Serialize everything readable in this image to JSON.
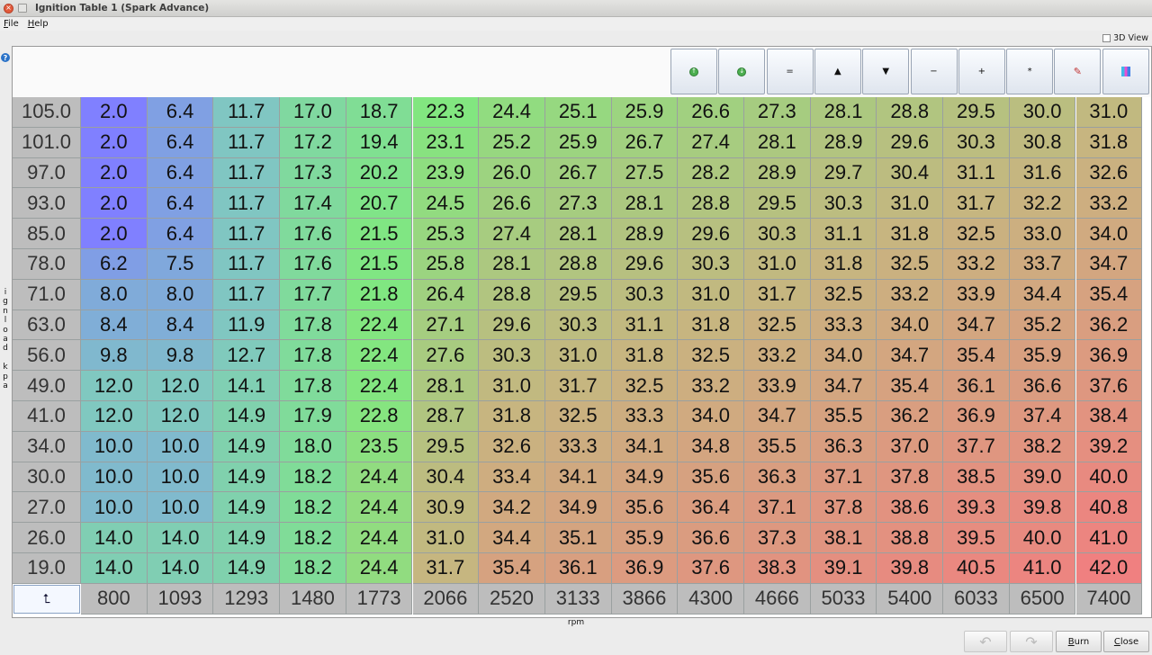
{
  "window": {
    "title": "Ignition Table 1 (Spark Advance)",
    "close_glyph": "×",
    "max_glyph": "▢"
  },
  "menu": {
    "file": {
      "u": "F",
      "rest": "ile"
    },
    "help": {
      "u": "H",
      "rest": "elp"
    }
  },
  "view3d_label": "3D View",
  "help_glyph": "?",
  "y_axis_label": "ignload kpa",
  "x_axis_label": "rpm",
  "toolbar": [
    {
      "name": "increase-button",
      "glyph": "↑",
      "green": true
    },
    {
      "name": "decrease-button",
      "glyph": "↓",
      "green": true
    },
    {
      "name": "set-equal-button",
      "glyph": "=",
      "green": false
    },
    {
      "name": "increment-button",
      "glyph": "▲",
      "green": false
    },
    {
      "name": "decrement-button",
      "glyph": "▼",
      "green": false
    },
    {
      "name": "subtract-button",
      "glyph": "−",
      "green": false
    },
    {
      "name": "add-button",
      "glyph": "+",
      "green": false
    },
    {
      "name": "multiply-button",
      "glyph": "*",
      "green": false
    },
    {
      "name": "interpolate-button",
      "glyph": "✎",
      "green": false
    },
    {
      "name": "color-scale-button",
      "glyph": "▮",
      "green": false
    }
  ],
  "corner_glyph": "⮤",
  "y_values": [
    "105.0",
    "101.0",
    "97.0",
    "93.0",
    "85.0",
    "78.0",
    "71.0",
    "63.0",
    "56.0",
    "49.0",
    "41.0",
    "34.0",
    "30.0",
    "27.0",
    "26.0",
    "19.0"
  ],
  "x_values": [
    "800",
    "1093",
    "1293",
    "1480",
    "1773",
    "2066",
    "2520",
    "3133",
    "3866",
    "4300",
    "4666",
    "5033",
    "5400",
    "6033",
    "6500",
    "7400"
  ],
  "table": [
    [
      "2.0",
      "6.4",
      "11.7",
      "17.0",
      "18.7",
      "22.3",
      "24.4",
      "25.1",
      "25.9",
      "26.6",
      "27.3",
      "28.1",
      "28.8",
      "29.5",
      "30.0",
      "31.0"
    ],
    [
      "2.0",
      "6.4",
      "11.7",
      "17.2",
      "19.4",
      "23.1",
      "25.2",
      "25.9",
      "26.7",
      "27.4",
      "28.1",
      "28.9",
      "29.6",
      "30.3",
      "30.8",
      "31.8"
    ],
    [
      "2.0",
      "6.4",
      "11.7",
      "17.3",
      "20.2",
      "23.9",
      "26.0",
      "26.7",
      "27.5",
      "28.2",
      "28.9",
      "29.7",
      "30.4",
      "31.1",
      "31.6",
      "32.6"
    ],
    [
      "2.0",
      "6.4",
      "11.7",
      "17.4",
      "20.7",
      "24.5",
      "26.6",
      "27.3",
      "28.1",
      "28.8",
      "29.5",
      "30.3",
      "31.0",
      "31.7",
      "32.2",
      "33.2"
    ],
    [
      "2.0",
      "6.4",
      "11.7",
      "17.6",
      "21.5",
      "25.3",
      "27.4",
      "28.1",
      "28.9",
      "29.6",
      "30.3",
      "31.1",
      "31.8",
      "32.5",
      "33.0",
      "34.0"
    ],
    [
      "6.2",
      "7.5",
      "11.7",
      "17.6",
      "21.5",
      "25.8",
      "28.1",
      "28.8",
      "29.6",
      "30.3",
      "31.0",
      "31.8",
      "32.5",
      "33.2",
      "33.7",
      "34.7"
    ],
    [
      "8.0",
      "8.0",
      "11.7",
      "17.7",
      "21.8",
      "26.4",
      "28.8",
      "29.5",
      "30.3",
      "31.0",
      "31.7",
      "32.5",
      "33.2",
      "33.9",
      "34.4",
      "35.4"
    ],
    [
      "8.4",
      "8.4",
      "11.9",
      "17.8",
      "22.4",
      "27.1",
      "29.6",
      "30.3",
      "31.1",
      "31.8",
      "32.5",
      "33.3",
      "34.0",
      "34.7",
      "35.2",
      "36.2"
    ],
    [
      "9.8",
      "9.8",
      "12.7",
      "17.8",
      "22.4",
      "27.6",
      "30.3",
      "31.0",
      "31.8",
      "32.5",
      "33.2",
      "34.0",
      "34.7",
      "35.4",
      "35.9",
      "36.9"
    ],
    [
      "12.0",
      "12.0",
      "14.1",
      "17.8",
      "22.4",
      "28.1",
      "31.0",
      "31.7",
      "32.5",
      "33.2",
      "33.9",
      "34.7",
      "35.4",
      "36.1",
      "36.6",
      "37.6"
    ],
    [
      "12.0",
      "12.0",
      "14.9",
      "17.9",
      "22.8",
      "28.7",
      "31.8",
      "32.5",
      "33.3",
      "34.0",
      "34.7",
      "35.5",
      "36.2",
      "36.9",
      "37.4",
      "38.4"
    ],
    [
      "10.0",
      "10.0",
      "14.9",
      "18.0",
      "23.5",
      "29.5",
      "32.6",
      "33.3",
      "34.1",
      "34.8",
      "35.5",
      "36.3",
      "37.0",
      "37.7",
      "38.2",
      "39.2"
    ],
    [
      "10.0",
      "10.0",
      "14.9",
      "18.2",
      "24.4",
      "30.4",
      "33.4",
      "34.1",
      "34.9",
      "35.6",
      "36.3",
      "37.1",
      "37.8",
      "38.5",
      "39.0",
      "40.0"
    ],
    [
      "10.0",
      "10.0",
      "14.9",
      "18.2",
      "24.4",
      "30.9",
      "34.2",
      "34.9",
      "35.6",
      "36.4",
      "37.1",
      "37.8",
      "38.6",
      "39.3",
      "39.8",
      "40.8"
    ],
    [
      "14.0",
      "14.0",
      "14.9",
      "18.2",
      "24.4",
      "31.0",
      "34.4",
      "35.1",
      "35.9",
      "36.6",
      "37.3",
      "38.1",
      "38.8",
      "39.5",
      "40.0",
      "41.0"
    ],
    [
      "14.0",
      "14.0",
      "14.9",
      "18.2",
      "24.4",
      "31.7",
      "35.4",
      "36.1",
      "36.9",
      "37.6",
      "38.3",
      "39.1",
      "39.8",
      "40.5",
      "41.0",
      "42.0"
    ]
  ],
  "color_scale": [
    "#8080ff",
    "#80c8c0",
    "#80e880",
    "#c8b480",
    "#f08080"
  ],
  "buttons": {
    "undo_glyph": "↶",
    "redo_glyph": "↷",
    "burn": {
      "u": "B",
      "rest": "urn"
    },
    "close": {
      "u": "C",
      "rest": "lose"
    }
  }
}
